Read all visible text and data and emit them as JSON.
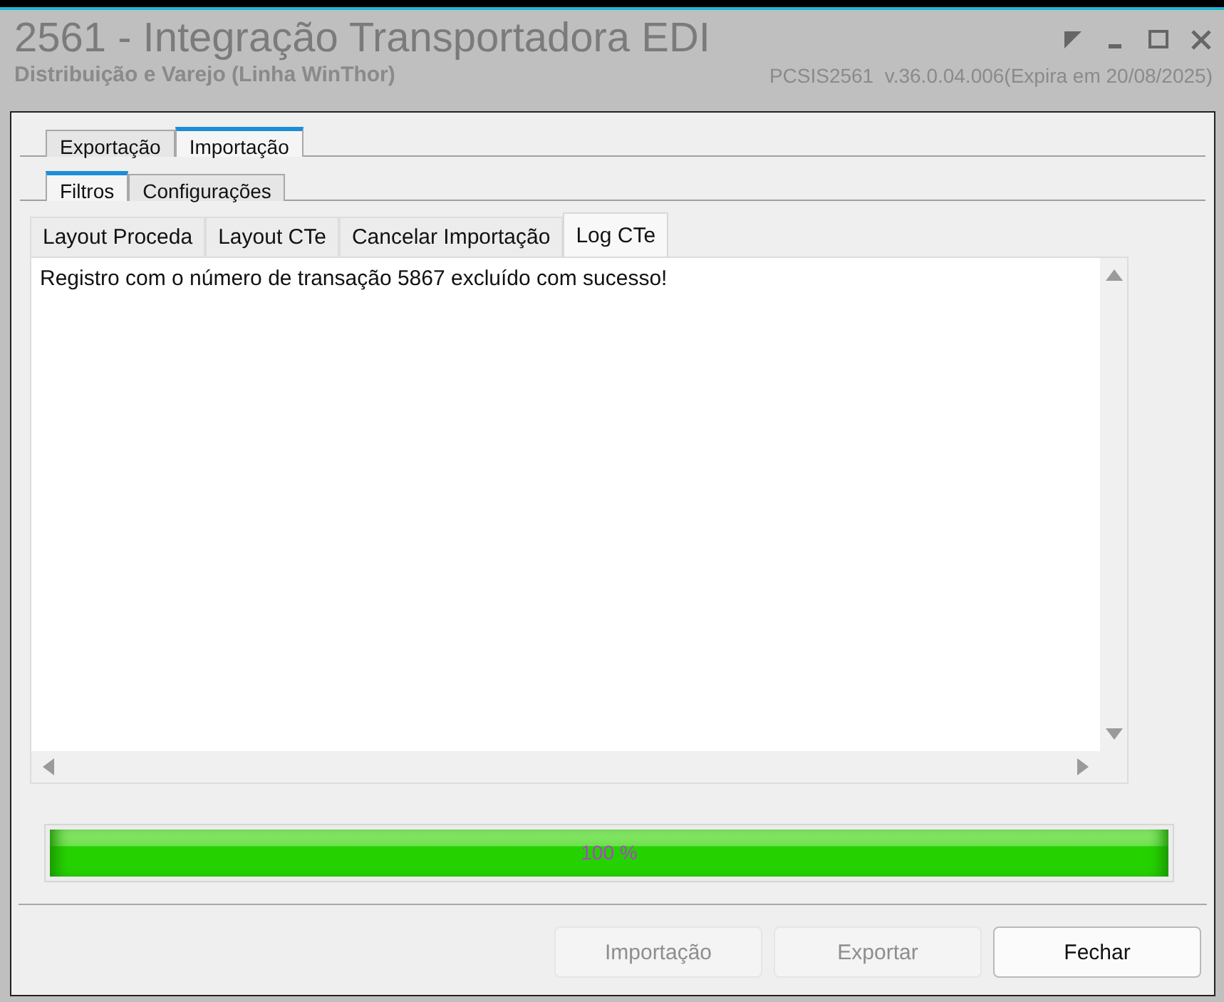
{
  "window": {
    "title": "2561 - Integração Transportadora EDI",
    "subtitle": "Distribuição e Varejo (Linha WinThor)",
    "version": "PCSIS2561  v.36.0.04.006(Expira em 20/08/2025)"
  },
  "main_tabs": [
    {
      "label": "Exportação",
      "selected": false
    },
    {
      "label": "Importação",
      "selected": true
    }
  ],
  "sub_tabs": [
    {
      "label": "Filtros",
      "selected": true
    },
    {
      "label": "Configurações",
      "selected": false
    }
  ],
  "inner_tabs": [
    {
      "label": "Layout Proceda",
      "selected": false
    },
    {
      "label": "Layout CTe",
      "selected": false
    },
    {
      "label": "Cancelar Importação",
      "selected": false
    },
    {
      "label": "Log CTe",
      "selected": true
    }
  ],
  "log": [
    "Registro com o número de transação 5867 excluído com sucesso!"
  ],
  "progress": {
    "level": 1,
    "label": "100 %"
  },
  "buttons": [
    {
      "label": "Importação",
      "disabled": true
    },
    {
      "label": "Exportar",
      "disabled": true
    },
    {
      "label": "Fechar",
      "disabled": false
    }
  ]
}
